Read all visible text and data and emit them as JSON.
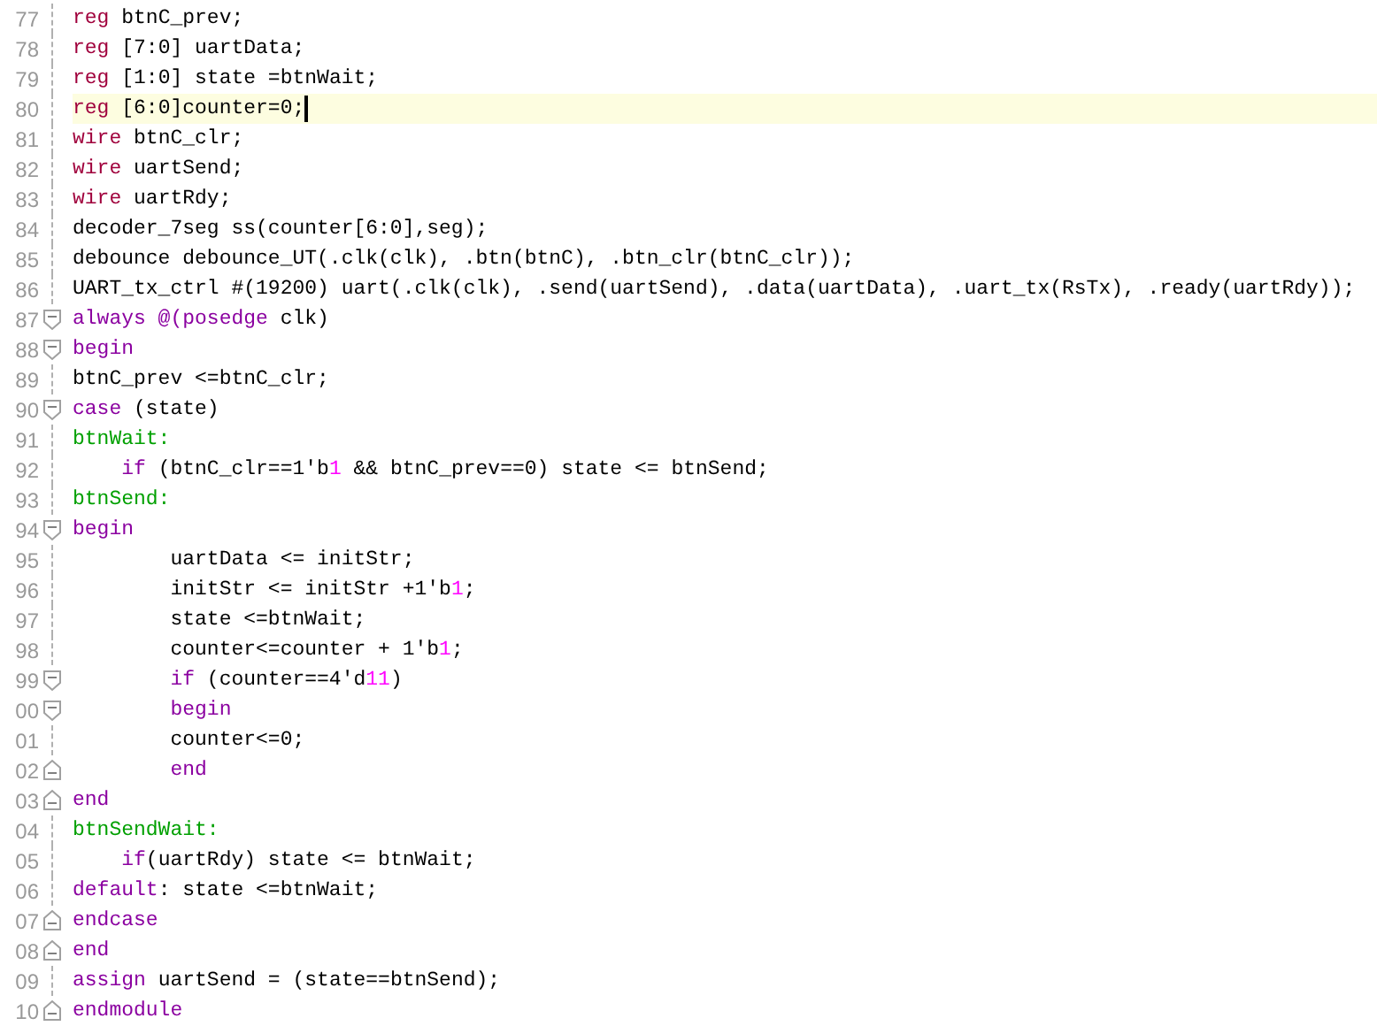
{
  "editor": {
    "lines": [
      {
        "number": "77",
        "fold_start": false,
        "fold_end": false,
        "current": false,
        "tokens": [
          {
            "kind": "type",
            "text": "reg"
          },
          {
            "kind": "plain",
            "text": " btnC_prev;"
          }
        ]
      },
      {
        "number": "78",
        "fold_start": false,
        "fold_end": false,
        "current": false,
        "tokens": [
          {
            "kind": "type",
            "text": "reg"
          },
          {
            "kind": "plain",
            "text": " [7:0] uartData;"
          }
        ]
      },
      {
        "number": "79",
        "fold_start": false,
        "fold_end": false,
        "current": false,
        "tokens": [
          {
            "kind": "type",
            "text": "reg"
          },
          {
            "kind": "plain",
            "text": " [1:0] state =btnWait;"
          }
        ]
      },
      {
        "number": "80",
        "fold_start": false,
        "fold_end": false,
        "current": true,
        "tokens": [
          {
            "kind": "type",
            "text": "reg"
          },
          {
            "kind": "plain",
            "text": " [6:0]counter=0;"
          }
        ]
      },
      {
        "number": "81",
        "fold_start": false,
        "fold_end": false,
        "current": false,
        "tokens": [
          {
            "kind": "type",
            "text": "wire"
          },
          {
            "kind": "plain",
            "text": " btnC_clr;"
          }
        ]
      },
      {
        "number": "82",
        "fold_start": false,
        "fold_end": false,
        "current": false,
        "tokens": [
          {
            "kind": "type",
            "text": "wire"
          },
          {
            "kind": "plain",
            "text": " uartSend;"
          }
        ]
      },
      {
        "number": "83",
        "fold_start": false,
        "fold_end": false,
        "current": false,
        "tokens": [
          {
            "kind": "type",
            "text": "wire"
          },
          {
            "kind": "plain",
            "text": " uartRdy;"
          }
        ]
      },
      {
        "number": "84",
        "fold_start": false,
        "fold_end": false,
        "current": false,
        "tokens": [
          {
            "kind": "plain",
            "text": "decoder_7seg ss(counter[6:0],seg);"
          }
        ]
      },
      {
        "number": "85",
        "fold_start": false,
        "fold_end": false,
        "current": false,
        "tokens": [
          {
            "kind": "plain",
            "text": "debounce debounce_UT(.clk(clk), .btn(btnC), .btn_clr(btnC_clr));"
          }
        ]
      },
      {
        "number": "86",
        "fold_start": false,
        "fold_end": false,
        "current": false,
        "tokens": [
          {
            "kind": "plain",
            "text": "UART_tx_ctrl #(19200) uart(.clk(clk), .send(uartSend), .data(uartData), .uart_tx(RsTx), .ready(uartRdy));"
          }
        ]
      },
      {
        "number": "87",
        "fold_start": true,
        "fold_end": false,
        "current": false,
        "tokens": [
          {
            "kind": "keyword",
            "text": "always @(posedge"
          },
          {
            "kind": "plain",
            "text": " clk)"
          }
        ]
      },
      {
        "number": "88",
        "fold_start": true,
        "fold_end": false,
        "current": false,
        "tokens": [
          {
            "kind": "keyword",
            "text": "begin"
          }
        ]
      },
      {
        "number": "89",
        "fold_start": false,
        "fold_end": false,
        "current": false,
        "tokens": [
          {
            "kind": "plain",
            "text": "btnC_prev <=btnC_clr;"
          }
        ]
      },
      {
        "number": "90",
        "fold_start": true,
        "fold_end": false,
        "current": false,
        "tokens": [
          {
            "kind": "keyword",
            "text": "case"
          },
          {
            "kind": "plain",
            "text": " (state)"
          }
        ]
      },
      {
        "number": "91",
        "fold_start": false,
        "fold_end": false,
        "current": false,
        "tokens": [
          {
            "kind": "label",
            "text": "btnWait:"
          }
        ]
      },
      {
        "number": "92",
        "fold_start": false,
        "fold_end": false,
        "current": false,
        "tokens": [
          {
            "kind": "keyword",
            "text": "    if"
          },
          {
            "kind": "plain",
            "text": " (btnC_clr==1'b"
          },
          {
            "kind": "number",
            "text": "1"
          },
          {
            "kind": "plain",
            "text": " && btnC_prev==0) state <= btnSend;"
          }
        ]
      },
      {
        "number": "93",
        "fold_start": false,
        "fold_end": false,
        "current": false,
        "tokens": [
          {
            "kind": "label",
            "text": "btnSend:"
          }
        ]
      },
      {
        "number": "94",
        "fold_start": true,
        "fold_end": false,
        "current": false,
        "tokens": [
          {
            "kind": "keyword",
            "text": "begin"
          }
        ]
      },
      {
        "number": "95",
        "fold_start": false,
        "fold_end": false,
        "current": false,
        "tokens": [
          {
            "kind": "plain",
            "text": "        uartData <= initStr;"
          }
        ]
      },
      {
        "number": "96",
        "fold_start": false,
        "fold_end": false,
        "current": false,
        "tokens": [
          {
            "kind": "plain",
            "text": "        initStr <= initStr +1'b"
          },
          {
            "kind": "number",
            "text": "1"
          },
          {
            "kind": "plain",
            "text": ";"
          }
        ]
      },
      {
        "number": "97",
        "fold_start": false,
        "fold_end": false,
        "current": false,
        "tokens": [
          {
            "kind": "plain",
            "text": "        state <=btnWait;"
          }
        ]
      },
      {
        "number": "98",
        "fold_start": false,
        "fold_end": false,
        "current": false,
        "tokens": [
          {
            "kind": "plain",
            "text": "        counter<=counter + 1'b"
          },
          {
            "kind": "number",
            "text": "1"
          },
          {
            "kind": "plain",
            "text": ";"
          }
        ]
      },
      {
        "number": "99",
        "fold_start": true,
        "fold_end": false,
        "current": false,
        "tokens": [
          {
            "kind": "keyword",
            "text": "        if"
          },
          {
            "kind": "plain",
            "text": " (counter==4'd"
          },
          {
            "kind": "number",
            "text": "11"
          },
          {
            "kind": "plain",
            "text": ")"
          }
        ]
      },
      {
        "number": "00",
        "fold_start": true,
        "fold_end": false,
        "current": false,
        "tokens": [
          {
            "kind": "keyword",
            "text": "        begin"
          }
        ]
      },
      {
        "number": "01",
        "fold_start": false,
        "fold_end": false,
        "current": false,
        "tokens": [
          {
            "kind": "plain",
            "text": "        counter<=0;"
          }
        ]
      },
      {
        "number": "02",
        "fold_start": false,
        "fold_end": true,
        "current": false,
        "tokens": [
          {
            "kind": "keyword",
            "text": "        end"
          }
        ]
      },
      {
        "number": "03",
        "fold_start": false,
        "fold_end": true,
        "current": false,
        "tokens": [
          {
            "kind": "keyword",
            "text": "end"
          }
        ]
      },
      {
        "number": "04",
        "fold_start": false,
        "fold_end": false,
        "current": false,
        "tokens": [
          {
            "kind": "label",
            "text": "btnSendWait:"
          }
        ]
      },
      {
        "number": "05",
        "fold_start": false,
        "fold_end": false,
        "current": false,
        "tokens": [
          {
            "kind": "keyword",
            "text": "    if"
          },
          {
            "kind": "plain",
            "text": "(uartRdy) state <= btnWait;"
          }
        ]
      },
      {
        "number": "06",
        "fold_start": false,
        "fold_end": false,
        "current": false,
        "tokens": [
          {
            "kind": "keyword",
            "text": "default"
          },
          {
            "kind": "plain",
            "text": ": state <=btnWait;"
          }
        ]
      },
      {
        "number": "07",
        "fold_start": false,
        "fold_end": true,
        "current": false,
        "tokens": [
          {
            "kind": "keyword",
            "text": "endcase"
          }
        ]
      },
      {
        "number": "08",
        "fold_start": false,
        "fold_end": true,
        "current": false,
        "tokens": [
          {
            "kind": "keyword",
            "text": "end"
          }
        ]
      },
      {
        "number": "09",
        "fold_start": false,
        "fold_end": false,
        "current": false,
        "tokens": [
          {
            "kind": "keyword",
            "text": "assign"
          },
          {
            "kind": "plain",
            "text": " uartSend = (state==btnSend);"
          }
        ]
      },
      {
        "number": "10",
        "fold_start": false,
        "fold_end": true,
        "current": false,
        "tokens": [
          {
            "kind": "keyword",
            "text": "endmodule"
          }
        ]
      }
    ]
  }
}
